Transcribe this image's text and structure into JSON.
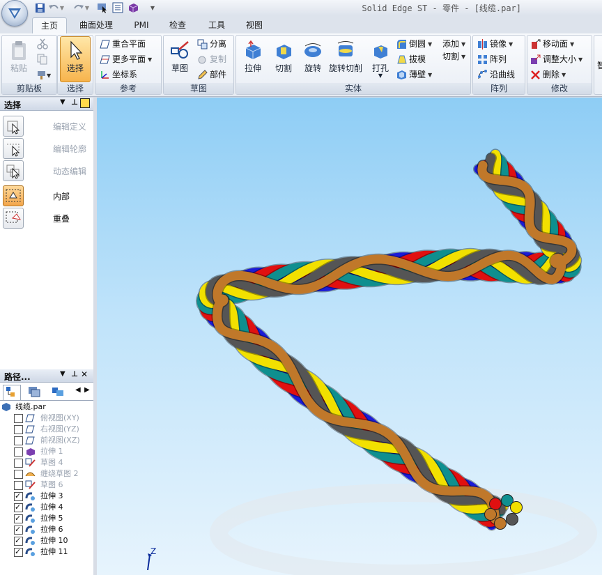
{
  "window": {
    "title": "Solid Edge ST - 零件 - [线缆.par]"
  },
  "tabs": [
    "主页",
    "曲面处理",
    "PMI",
    "检查",
    "工具",
    "视图"
  ],
  "ribbon": {
    "clipboard": {
      "label": "剪贴板",
      "paste": "粘贴"
    },
    "select": {
      "label": "选择",
      "select": "选择"
    },
    "reference": {
      "label": "参考",
      "coincident_plane": "重合平面",
      "more_planes": "更多平面",
      "coord_system": "坐标系"
    },
    "sketch": {
      "label": "草图",
      "sketch": "草图",
      "detach": "分离",
      "copy": "复制",
      "part": "部件"
    },
    "solid": {
      "label": "实体",
      "extrude": "拉伸",
      "cut": "切割",
      "revolve": "旋转",
      "revolve_cut": "旋转切削",
      "hole": "打孔",
      "round": "倒圆",
      "draft": "拔模",
      "thin_wall": "薄壁",
      "add": "添加",
      "cut_small": "切割"
    },
    "pattern": {
      "label": "阵列",
      "mirror": "镜像",
      "pattern": "阵列",
      "along_curve": "沿曲线"
    },
    "modify": {
      "label": "修改",
      "move_face": "移动面",
      "resize": "调整大小",
      "delete": "删除"
    },
    "extra": "智"
  },
  "select_panel": {
    "title": "选择",
    "items": [
      {
        "label": "编辑定义",
        "enabled": false,
        "active": false
      },
      {
        "label": "编辑轮廓",
        "enabled": false,
        "active": false
      },
      {
        "label": "动态编辑",
        "enabled": false,
        "active": false
      },
      {
        "label": "内部",
        "enabled": true,
        "active": true
      },
      {
        "label": "重叠",
        "enabled": true,
        "active": false
      }
    ]
  },
  "path_panel": {
    "title": "路径...",
    "root": "线缆.par",
    "items": [
      {
        "label": "俯视图(XY)",
        "checked": false,
        "enabled": false,
        "icon": "plane-icon"
      },
      {
        "label": "右视图(YZ)",
        "checked": false,
        "enabled": false,
        "icon": "plane-icon"
      },
      {
        "label": "前视图(XZ)",
        "checked": false,
        "enabled": false,
        "icon": "plane-icon"
      },
      {
        "label": "拉伸 1",
        "checked": false,
        "enabled": false,
        "icon": "extrude-icon"
      },
      {
        "label": "草图 4",
        "checked": false,
        "enabled": false,
        "icon": "sketch-icon"
      },
      {
        "label": "缠绕草图 2",
        "checked": false,
        "enabled": false,
        "icon": "wrap-sketch-icon"
      },
      {
        "label": "草图 6",
        "checked": false,
        "enabled": false,
        "icon": "sketch-icon"
      },
      {
        "label": "拉伸 3",
        "checked": true,
        "enabled": true,
        "icon": "sweep-icon"
      },
      {
        "label": "拉伸 4",
        "checked": true,
        "enabled": true,
        "icon": "sweep-icon"
      },
      {
        "label": "拉伸 5",
        "checked": true,
        "enabled": true,
        "icon": "sweep-icon"
      },
      {
        "label": "拉伸 6",
        "checked": true,
        "enabled": true,
        "icon": "sweep-icon"
      },
      {
        "label": "拉伸 10",
        "checked": true,
        "enabled": true,
        "icon": "sweep-icon"
      },
      {
        "label": "拉伸 11",
        "checked": true,
        "enabled": true,
        "icon": "sweep-icon"
      }
    ]
  },
  "viewport": {
    "axis_label": "Z"
  },
  "model": {
    "strand_colors": [
      "#1b1bd8",
      "#e01010",
      "#0f8f8f",
      "#f2e000",
      "#555555",
      "#c0782a"
    ]
  }
}
